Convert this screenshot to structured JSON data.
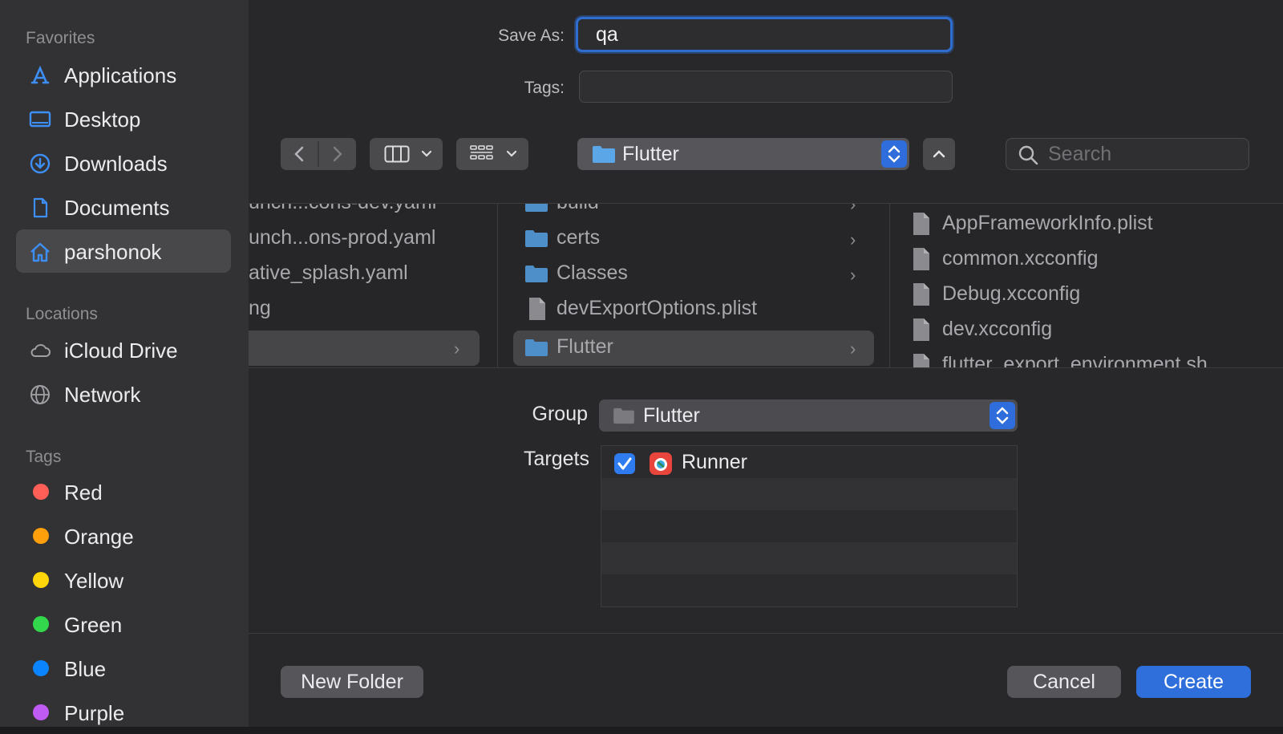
{
  "sidebar": {
    "favorites_heading": "Favorites",
    "favorites": [
      {
        "label": "Applications",
        "icon": "applications-icon"
      },
      {
        "label": "Desktop",
        "icon": "desktop-icon"
      },
      {
        "label": "Downloads",
        "icon": "downloads-icon"
      },
      {
        "label": "Documents",
        "icon": "documents-icon"
      },
      {
        "label": "parshonok",
        "icon": "home-icon",
        "selected": true
      }
    ],
    "locations_heading": "Locations",
    "locations": [
      {
        "label": "iCloud Drive",
        "icon": "cloud-icon"
      },
      {
        "label": "Network",
        "icon": "globe-icon"
      }
    ],
    "tags_heading": "Tags",
    "tags": [
      {
        "label": "Red",
        "color": "#ff5f57"
      },
      {
        "label": "Orange",
        "color": "#ff9f0a"
      },
      {
        "label": "Yellow",
        "color": "#ffd60a"
      },
      {
        "label": "Green",
        "color": "#32d74b"
      },
      {
        "label": "Blue",
        "color": "#0a84ff"
      },
      {
        "label": "Purple",
        "color": "#bf5af2"
      }
    ]
  },
  "save_as": {
    "label": "Save As:",
    "value": "qa"
  },
  "tags_field": {
    "label": "Tags:",
    "value": ""
  },
  "toolbar": {
    "location_popup": "Flutter",
    "search_placeholder": "Search"
  },
  "browser": {
    "column1": [
      {
        "name": "unch...cons-dev.yaml"
      },
      {
        "name": "unch...ons-prod.yaml"
      },
      {
        "name": "ative_splash.yaml"
      },
      {
        "name": "ng"
      },
      {
        "name": "",
        "selected": true,
        "has_children": true
      }
    ],
    "column2": [
      {
        "name": "build",
        "type": "folder",
        "has_children": true
      },
      {
        "name": "certs",
        "type": "folder",
        "has_children": true
      },
      {
        "name": "Classes",
        "type": "folder",
        "has_children": true
      },
      {
        "name": "devExportOptions.plist",
        "type": "plist"
      },
      {
        "name": "Flutter",
        "type": "folder",
        "has_children": true,
        "selected": true
      }
    ],
    "column3": [
      {
        "name": "AppFrameworkInfo.plist",
        "type": "plist"
      },
      {
        "name": "common.xcconfig",
        "type": "file"
      },
      {
        "name": "Debug.xcconfig",
        "type": "file"
      },
      {
        "name": "dev.xcconfig",
        "type": "file"
      },
      {
        "name": "flutter_export_environment.sh",
        "type": "file"
      }
    ]
  },
  "group": {
    "label": "Group",
    "value": "Flutter"
  },
  "targets": {
    "label": "Targets",
    "items": [
      {
        "name": "Runner",
        "checked": true
      }
    ]
  },
  "buttons": {
    "new_folder": "New Folder",
    "cancel": "Cancel",
    "create": "Create"
  },
  "colors": {
    "accent": "#2e6fdc",
    "folder": "#5aa6e6"
  }
}
